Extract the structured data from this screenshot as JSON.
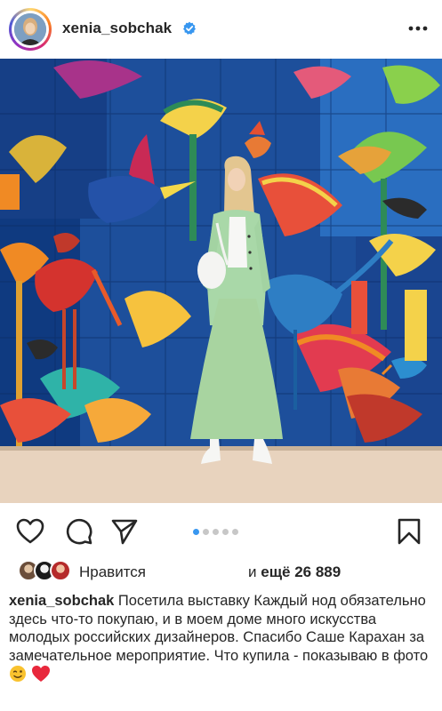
{
  "header": {
    "username": "xenia_sobchak",
    "verified_icon": "verified-badge-icon",
    "more_icon": "more-options-icon"
  },
  "post": {
    "image_icon": "post-photo",
    "carousel": {
      "total": 5,
      "active_index": 0
    }
  },
  "actions": {
    "like_icon": "heart-icon",
    "comment_icon": "comment-icon",
    "share_icon": "send-icon",
    "save_icon": "bookmark-icon"
  },
  "likes": {
    "label": "Нравится",
    "prefix": "и",
    "more_text": "ещё 26 889"
  },
  "caption": {
    "username": "xenia_sobchak",
    "text": "Посетила выставку Каждый нод обязательно здесь что-то покупаю, и в моем доме много искусства молодых российских дизайнеров. Спасибо Саше Карахан за замечательное мероприятие. Что купила - показываю в фото",
    "emojis": [
      "wink-emoji",
      "red-heart-emoji"
    ]
  },
  "colors": {
    "accent": "#3897f0",
    "text": "#262626",
    "verified": "#3897f0"
  }
}
